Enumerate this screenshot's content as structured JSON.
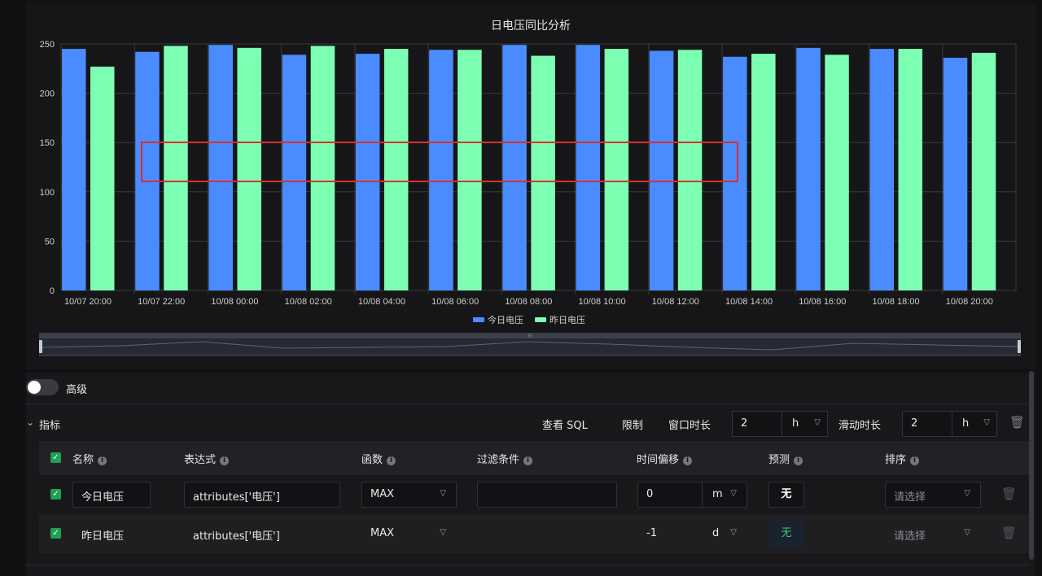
{
  "chart": {
    "title": "日电压同比分析",
    "colors": {
      "today": "#4a8cff",
      "yesterday": "#7dffb3"
    }
  },
  "chart_data": {
    "type": "bar",
    "title": "日电压同比分析",
    "categories": [
      "10/07 20:00",
      "10/07 22:00",
      "10/08 00:00",
      "10/08 02:00",
      "10/08 04:00",
      "10/08 06:00",
      "10/08 08:00",
      "10/08 10:00",
      "10/08 12:00",
      "10/08 14:00",
      "10/08 16:00",
      "10/08 18:00",
      "10/08 20:00"
    ],
    "series": [
      {
        "name": "今日电压",
        "values": [
          245,
          242,
          249,
          239,
          240,
          244,
          249,
          249,
          243,
          237,
          246,
          245,
          236
        ]
      },
      {
        "name": "昨日电压",
        "values": [
          227,
          248,
          246,
          248,
          245,
          244,
          238,
          245,
          244,
          240,
          239,
          245,
          241
        ]
      }
    ],
    "ylim": [
      0,
      250
    ],
    "yticks": [
      0,
      50,
      100,
      150,
      200,
      250
    ],
    "grid": true,
    "legend": "bottom-center"
  },
  "advanced": {
    "label": "高级",
    "enabled": false
  },
  "metrics": {
    "title": "指标",
    "view_sql": "查看 SQL",
    "limit": "限制",
    "window_label": "窗口时长",
    "window_value": "2",
    "window_unit": "h",
    "slide_label": "滑动时长",
    "slide_value": "2",
    "slide_unit": "h"
  },
  "table": {
    "headers": {
      "name": "名称",
      "expr": "表达式",
      "func": "函数",
      "filter": "过滤条件",
      "offset": "时间偏移",
      "predict": "预测",
      "sort": "排序"
    },
    "rows": [
      {
        "name": "今日电压",
        "expr": "attributes['电压']",
        "func": "MAX",
        "filter": "",
        "offset": "0",
        "offset_unit": "m",
        "predict": "无",
        "sort_placeholder": "请选择"
      },
      {
        "name": "昨日电压",
        "expr": "attributes['电压']",
        "func": "MAX",
        "filter": "",
        "offset": "-1",
        "offset_unit": "d",
        "predict": "无",
        "sort_placeholder": "请选择"
      }
    ]
  }
}
